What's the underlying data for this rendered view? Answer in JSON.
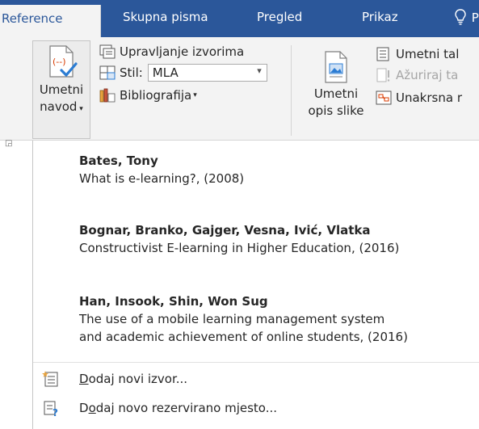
{
  "tabs": [
    {
      "label": "Reference",
      "active": true
    },
    {
      "label": "Skupna pisma"
    },
    {
      "label": "Pregled"
    },
    {
      "label": "Prikaz"
    }
  ],
  "tell_me_icon": "lightbulb-icon",
  "tell_me_partial": "P",
  "ribbon": {
    "insert_citation": {
      "line1": "Umetni",
      "line2": "navod",
      "icon": "citation-icon"
    },
    "manage_sources": "Upravljanje izvorima",
    "style_label": "Stil:",
    "style_value": "MLA",
    "bibliography": "Bibliografija",
    "insert_caption": {
      "line1": "Umetni",
      "line2": "opis slike",
      "icon": "caption-icon"
    },
    "insert_table_of_figures": "Umetni tal",
    "update_table": "Ažuriraj ta",
    "cross_reference": "Unakrsna r"
  },
  "sources": [
    {
      "author": "Bates, Tony",
      "title_lines": [
        "What is e-learning?, (2008)"
      ]
    },
    {
      "author": "Bognar, Branko, Gajger, Vesna,  Ivić, Vlatka",
      "title_lines": [
        "Constructivist E-learning in Higher Education, (2016)"
      ]
    },
    {
      "author": "Han, Insook,  Shin, Won Sug",
      "title_lines": [
        "The use of a mobile learning management system",
        "and academic achievement of online students, (2016)"
      ]
    }
  ],
  "menu": {
    "add_source": {
      "mnemonic": "D",
      "rest": "odaj novi izvor...",
      "icon": "add-source-icon"
    },
    "add_placeholder": {
      "pre": "D",
      "mnemonic": "o",
      "rest": "daj novo rezervirano mjesto...",
      "icon": "add-placeholder-icon"
    }
  },
  "colors": {
    "tab_bar": "#2b579a",
    "ribbon_bg": "#f3f3f3",
    "accent_red": "#d83b01",
    "accent_blue": "#2b7cd3"
  }
}
